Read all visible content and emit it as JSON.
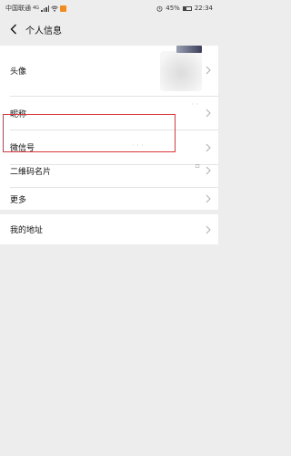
{
  "status_bar": {
    "carrier": "中国联通",
    "network": "4G",
    "battery": "45%",
    "time": "22:34"
  },
  "header": {
    "title": "个人信息"
  },
  "rows": {
    "avatar": {
      "label": "头像"
    },
    "nickname": {
      "label": "昵称"
    },
    "wechat_id": {
      "label": "微信号"
    },
    "qr_code": {
      "label": "二维码名片"
    },
    "more": {
      "label": "更多"
    },
    "address": {
      "label": "我的地址"
    }
  },
  "colors": {
    "background": "#ededed",
    "card": "#ffffff",
    "highlight": "#d9363e"
  },
  "icons": [
    "back-arrow-icon",
    "chevron-right-icon",
    "signal-icon",
    "wifi-icon",
    "alarm-icon",
    "battery-icon"
  ]
}
